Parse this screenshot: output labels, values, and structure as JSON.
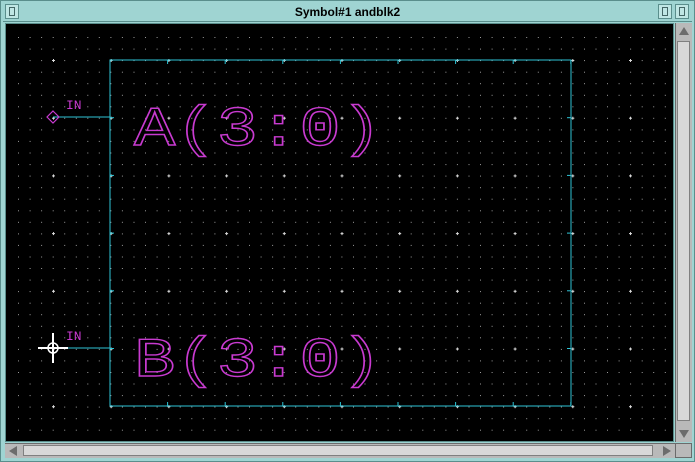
{
  "window": {
    "title": "Symbol#1 andblk2"
  },
  "canvas": {
    "background": "#000000",
    "grid_color": "#9a9a9a",
    "box_color": "#2ec4d6",
    "label_color": "#c83ad0"
  },
  "pins": [
    {
      "name": "A(3:0)",
      "direction": "IN"
    },
    {
      "name": "B(3:0)",
      "direction": "IN"
    }
  ]
}
